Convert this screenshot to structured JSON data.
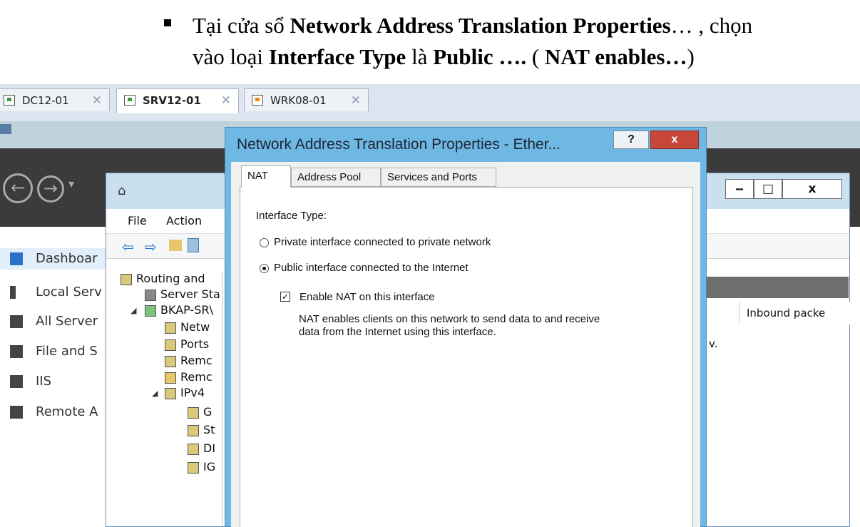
{
  "caption": {
    "line1": [
      {
        "text": "Tại cửa sổ ",
        "bold": false
      },
      {
        "text": "Network Address Translation Properties",
        "bold": true
      },
      {
        "text": "… , chọn",
        "bold": false
      }
    ],
    "line2": [
      {
        "text": "vào loại ",
        "bold": false
      },
      {
        "text": "Interface Type",
        "bold": true
      },
      {
        "text": " là ",
        "bold": false
      },
      {
        "text": "Public ….",
        "bold": true
      },
      {
        "text": " ( ",
        "bold": false
      },
      {
        "text": "NAT enables…",
        "bold": true
      },
      {
        "text": ")",
        "bold": false
      }
    ]
  },
  "vm_tabs": [
    {
      "label": "DC12-01",
      "close": "✕"
    },
    {
      "label": "SRV12-01",
      "close": "✕"
    },
    {
      "label": "WRK08-01",
      "close": "✕"
    }
  ],
  "server_manager": {
    "nav_items": [
      {
        "label": "Dashboar",
        "icon": "dashboard-icon"
      },
      {
        "label": "Local Serv",
        "icon": "local-server-icon"
      },
      {
        "label": "All Server",
        "icon": "all-servers-icon"
      },
      {
        "label": "File and S",
        "icon": "file-storage-icon"
      },
      {
        "label": "IIS",
        "icon": "iis-icon"
      },
      {
        "label": "Remote A",
        "icon": "remote-access-icon"
      }
    ]
  },
  "rras": {
    "menu": [
      "File",
      "Action"
    ],
    "window_buttons": [
      "‒",
      "□",
      "x"
    ],
    "tree": [
      {
        "label": "Routing and",
        "indent": 0
      },
      {
        "label": "Server Sta",
        "indent": 1
      },
      {
        "label": "BKAP-SR\\",
        "indent": 1
      },
      {
        "label": "Netw",
        "indent": 2
      },
      {
        "label": "Ports",
        "indent": 2
      },
      {
        "label": "Remc",
        "indent": 2
      },
      {
        "label": "Remc",
        "indent": 2
      },
      {
        "label": "IPv4",
        "indent": 2
      },
      {
        "label": "G",
        "indent": 3
      },
      {
        "label": "St",
        "indent": 3
      },
      {
        "label": "DI",
        "indent": 3
      },
      {
        "label": "IG",
        "indent": 3
      }
    ],
    "column_header": "Inbound packe",
    "trailing_text": "v."
  },
  "dialog": {
    "title": "Network Address Translation Properties - Ether...",
    "help": "?",
    "close": "x",
    "tabs": [
      "NAT",
      "Address Pool",
      "Services and Ports"
    ],
    "interface_type_label": "Interface Type:",
    "private_option": "Private interface connected to private network",
    "public_option": "Public interface connected to the Internet",
    "selected_option": "public",
    "enable_nat_label": "Enable NAT on this interface",
    "enable_nat_checked": true,
    "description_line1": "NAT enables clients on this network to send data to and receive",
    "description_line2": "data from the Internet using this interface."
  }
}
